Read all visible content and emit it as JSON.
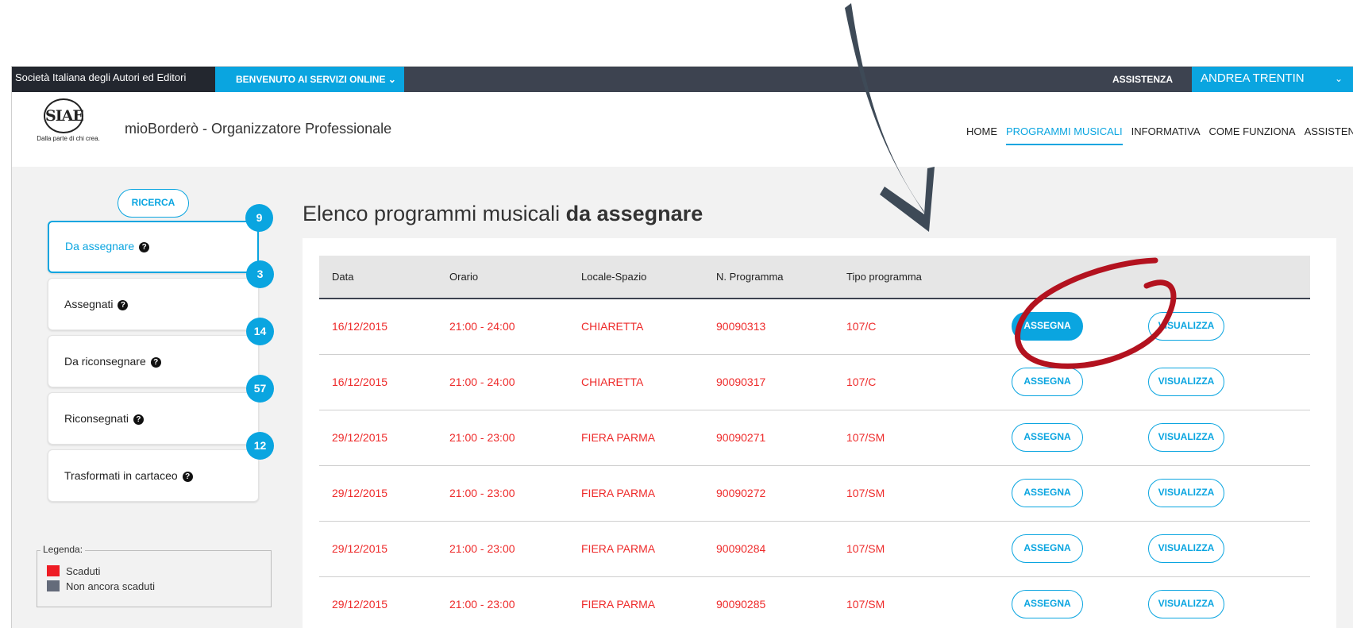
{
  "topbar": {
    "org": "Società Italiana degli Autori ed Editori",
    "welcome": "BENVENUTO AI SERVIZI ONLINE",
    "assist": "ASSISTENZA",
    "user": "ANDREA TRENTIN"
  },
  "header": {
    "logo_mark": "SIAE",
    "logo_tagline": "Dalla parte di chi crea.",
    "app_title": "mioBorderò - Organizzatore Professionale",
    "nav": [
      "HOME",
      "PROGRAMMI MUSICALI",
      "INFORMATIVA",
      "COME FUNZIONA",
      "ASSISTENZA"
    ],
    "nav_active_index": 1
  },
  "sidebar": {
    "search_label": "RICERCA",
    "cards": [
      {
        "label": "Da assegnare",
        "count": "9",
        "active": true
      },
      {
        "label": "Assegnati",
        "count": "3",
        "active": false
      },
      {
        "label": "Da riconsegnare",
        "count": "14",
        "active": false
      },
      {
        "label": "Riconsegnati",
        "count": "57",
        "active": false
      },
      {
        "label": "Trasformati in cartaceo",
        "count": "12",
        "active": false
      }
    ],
    "help_glyph": "?",
    "legend": {
      "title": "Legenda:",
      "items": [
        {
          "label": "Scaduti",
          "color": "#ee1c24"
        },
        {
          "label": "Non ancora scaduti",
          "color": "#646b7a"
        }
      ]
    }
  },
  "main": {
    "title_regular": "Elenco programmi musicali ",
    "title_bold": "da assegnare",
    "columns": [
      "Data",
      "Orario",
      "Locale-Spazio",
      "N. Programma",
      "Tipo programma"
    ],
    "assign_label": "ASSEGNA",
    "view_label": "VISUALIZZA",
    "rows": [
      {
        "data": "16/12/2015",
        "orario": "21:00 - 24:00",
        "locale": "CHIARETTA",
        "numero": "90090313",
        "tipo": "107/C",
        "highlight": true
      },
      {
        "data": "16/12/2015",
        "orario": "21:00 - 24:00",
        "locale": "CHIARETTA",
        "numero": "90090317",
        "tipo": "107/C",
        "highlight": false
      },
      {
        "data": "29/12/2015",
        "orario": "21:00 - 23:00",
        "locale": "FIERA PARMA",
        "numero": "90090271",
        "tipo": "107/SM",
        "highlight": false
      },
      {
        "data": "29/12/2015",
        "orario": "21:00 - 23:00",
        "locale": "FIERA PARMA",
        "numero": "90090272",
        "tipo": "107/SM",
        "highlight": false
      },
      {
        "data": "29/12/2015",
        "orario": "21:00 - 23:00",
        "locale": "FIERA PARMA",
        "numero": "90090284",
        "tipo": "107/SM",
        "highlight": false
      },
      {
        "data": "29/12/2015",
        "orario": "21:00 - 23:00",
        "locale": "FIERA PARMA",
        "numero": "90090285",
        "tipo": "107/SM",
        "highlight": false
      }
    ]
  },
  "colors": {
    "accent": "#0aa5e0",
    "expired_text": "#ee2b2b",
    "topbar_dark": "#3d4350",
    "annotation": "#b3121f",
    "arrow": "#3e4a57"
  }
}
